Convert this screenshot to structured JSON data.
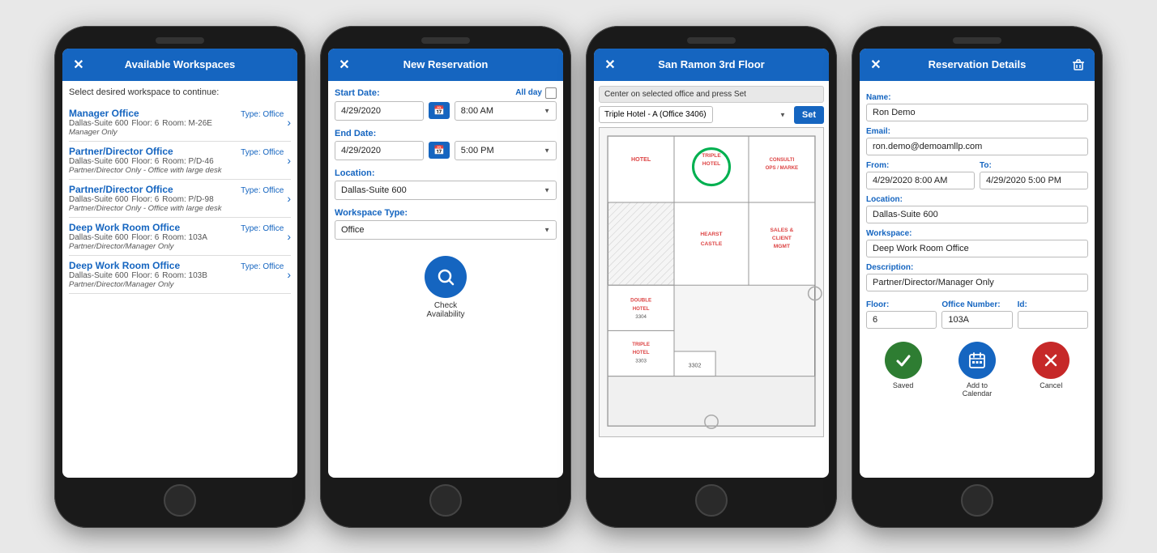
{
  "phone1": {
    "header": {
      "title": "Available Workspaces",
      "close_icon": "✕"
    },
    "subtitle": "Select desired workspace to continue:",
    "workspaces": [
      {
        "name": "Manager Office",
        "type": "Type: Office",
        "location": "Dallas-Suite 600",
        "floor": "Floor: 6",
        "room": "Room: M-26E",
        "note": "Manager Only"
      },
      {
        "name": "Partner/Director Office",
        "type": "Type: Office",
        "location": "Dallas-Suite 600",
        "floor": "Floor: 6",
        "room": "Room: P/D-46",
        "note": "Partner/Director Only - Office with large desk"
      },
      {
        "name": "Partner/Director Office",
        "type": "Type: Office",
        "location": "Dallas-Suite 600",
        "floor": "Floor: 6",
        "room": "Room: P/D-98",
        "note": "Partner/Director Only - Office with large desk"
      },
      {
        "name": "Deep Work Room Office",
        "type": "Type: Office",
        "location": "Dallas-Suite 600",
        "floor": "Floor: 6",
        "room": "Room: 103A",
        "note": "Partner/Director/Manager Only"
      },
      {
        "name": "Deep Work Room Office",
        "type": "Type: Office",
        "location": "Dallas-Suite 600",
        "floor": "Floor: 6",
        "room": "Room: 103B",
        "note": "Partner/Director/Manager Only"
      }
    ]
  },
  "phone2": {
    "header": {
      "title": "New Reservation",
      "close_icon": "✕"
    },
    "start_date_label": "Start Date:",
    "start_date_value": "4/29/2020",
    "start_time_value": "8:00 AM",
    "all_day_label": "All day",
    "end_date_label": "End Date:",
    "end_date_value": "4/29/2020",
    "end_time_value": "5:00 PM",
    "location_label": "Location:",
    "location_value": "Dallas-Suite 600",
    "workspace_type_label": "Workspace Type:",
    "workspace_type_value": "Office",
    "check_availability_label": "Check\nAvailability",
    "search_icon": "🔍"
  },
  "phone3": {
    "header": {
      "title": "San Ramon 3rd Floor",
      "close_icon": "✕"
    },
    "hint_text": "Center on selected office and press Set",
    "selector_value": "Triple Hotel - A (Office 3406)",
    "set_button_label": "Set",
    "map_rooms": [
      {
        "label": "TRIPLE\nHOTEL\n3406",
        "highlight": true
      },
      {
        "label": "HEARST\nCASTLE"
      },
      {
        "label": "SALES &\nCLIENT\nMGMT"
      },
      {
        "label": "DOUBLE\nHOTEL\n3304"
      },
      {
        "label": "TRIPLE\nHOTEL\n3303"
      },
      {
        "label": "3302"
      },
      {
        "label": "HOTEL"
      },
      {
        "label": "CONSULTI\nOPS / MARKE"
      }
    ]
  },
  "phone4": {
    "header": {
      "title": "Reservation Details",
      "close_icon": "✕",
      "trash_icon": "🗑"
    },
    "name_label": "Name:",
    "name_value": "Ron Demo",
    "email_label": "Email:",
    "email_value": "ron.demo@demoamllp.com",
    "from_label": "From:",
    "from_value": "4/29/2020 8:00 AM",
    "to_label": "To:",
    "to_value": "4/29/2020 5:00 PM",
    "location_label": "Location:",
    "location_value": "Dallas-Suite 600",
    "workspace_label": "Workspace:",
    "workspace_value": "Deep Work Room Office",
    "description_label": "Description:",
    "description_value": "Partner/Director/Manager Only",
    "floor_label": "Floor:",
    "floor_value": "6",
    "office_number_label": "Office Number:",
    "office_number_value": "103A",
    "id_label": "Id:",
    "id_value": "",
    "saved_label": "Saved",
    "calendar_label": "Add to\nCalendar",
    "cancel_label": "Cancel"
  }
}
